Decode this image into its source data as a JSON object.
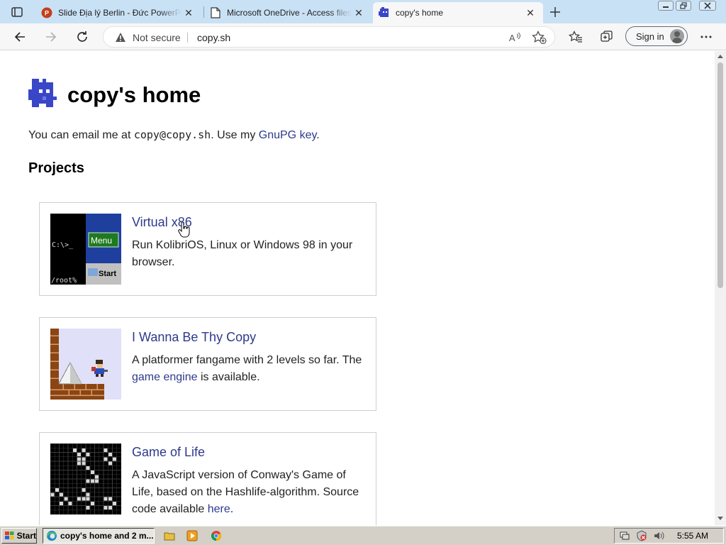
{
  "browser": {
    "tabs": [
      {
        "title": "Slide Địa lý Berlin - Đức PowerPoint",
        "favicon": "powerpoint-icon",
        "active": false
      },
      {
        "title": "Microsoft OneDrive - Access files",
        "favicon": "document-icon",
        "active": false
      },
      {
        "title": "copy's home",
        "favicon": "copy-logo-icon",
        "active": true
      }
    ],
    "security_label": "Not secure",
    "url": "copy.sh",
    "sign_in_label": "Sign in"
  },
  "page": {
    "title": "copy's home",
    "intro": {
      "prefix": "You can email me at ",
      "email": "copy@copy.sh",
      "middle": ". Use my ",
      "link": "GnuPG key",
      "suffix": "."
    },
    "projects_heading": "Projects",
    "projects": [
      {
        "title": "Virtual x86",
        "description": "Run KolibriOS, Linux or Windows 98 in your browser.",
        "thumb": {
          "prompt": "C:\\>_",
          "shell": "/root%",
          "menu": "Menu",
          "start": "Start"
        }
      },
      {
        "title": "I Wanna Be Thy Copy",
        "desc_prefix": "A platformer fangame with 2 levels so far. The ",
        "desc_link": "game engine",
        "desc_suffix": " is available."
      },
      {
        "title": "Game of Life",
        "desc_prefix": "A JavaScript version of Conway's Game of Life, based on the Hashlife-algorithm. Source code available ",
        "desc_link": "here",
        "desc_suffix": "."
      }
    ]
  },
  "taskbar": {
    "start_label": "Start",
    "task_label": "copy's home and 2 m...",
    "clock": "5:55 AM"
  },
  "colors": {
    "accent": "#2d3a8c",
    "tabstrip": "#c9e1f5",
    "logo": "#3a46c8"
  }
}
